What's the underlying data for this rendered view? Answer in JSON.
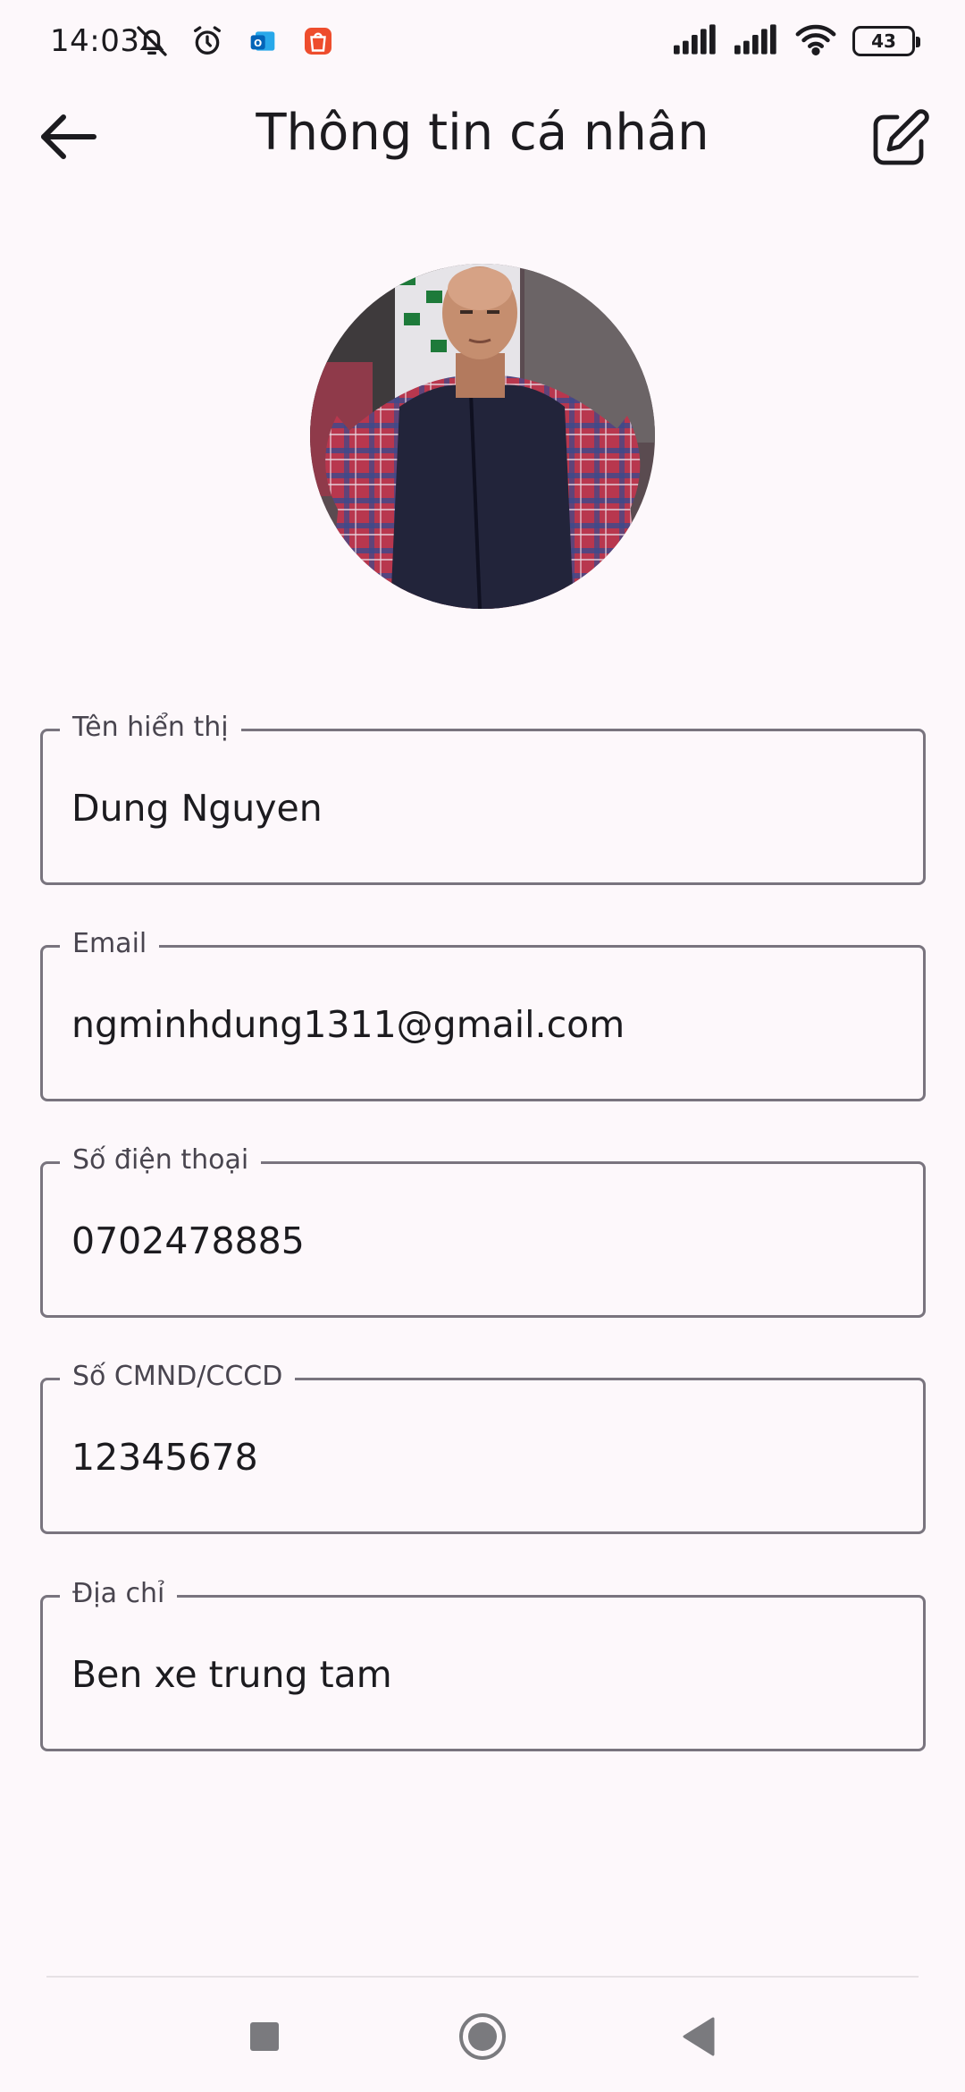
{
  "status_bar": {
    "time": "14:03",
    "icons_left": [
      "bell-off-icon",
      "alarm-clock-icon",
      "outlook-app-icon",
      "shopee-app-icon"
    ],
    "icons_right": [
      "signal-icon",
      "signal-icon",
      "wifi-icon"
    ],
    "battery": "43"
  },
  "app_bar": {
    "title": "Thông tin cá nhân",
    "back_icon": "arrow-left-icon",
    "edit_icon": "edit-icon"
  },
  "profile": {
    "avatar": "profile-photo"
  },
  "fields": [
    {
      "label": "Tên hiển thị",
      "value": "Dung Nguyen"
    },
    {
      "label": "Email",
      "value": "ngminhdung1311@gmail.com"
    },
    {
      "label": "Số điện thoại",
      "value": "0702478885"
    },
    {
      "label": "Số CMND/CCCD",
      "value": "12345678"
    },
    {
      "label": "Địa chỉ",
      "value": "Ben xe trung tam"
    }
  ],
  "nav_bar": {
    "buttons": [
      "recents-square-icon",
      "home-circle-icon",
      "back-triangle-icon"
    ]
  },
  "colors": {
    "background": "#fdf8fb",
    "outline": "#79747e",
    "text": "#1c1b1f",
    "label": "#49454f"
  }
}
